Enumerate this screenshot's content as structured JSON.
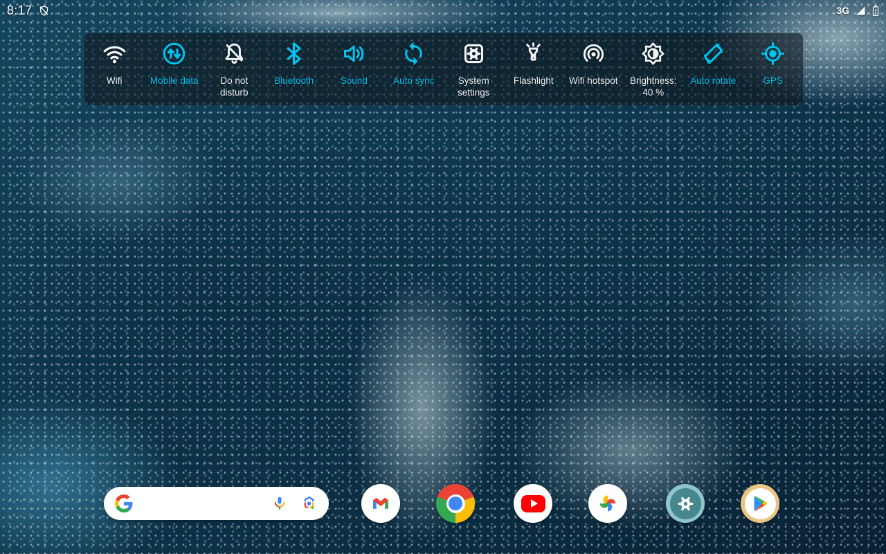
{
  "status_bar": {
    "time": "8:17",
    "shield_icon": "shield-off-icon",
    "network_type": "3G",
    "signal_icon": "signal-full-icon",
    "battery_icon": "battery-icon"
  },
  "quick_settings": {
    "accent_color": "#00c4f0",
    "inactive_color": "#f2f4f5",
    "tiles": [
      {
        "id": "wifi",
        "label": "Wifi",
        "icon": "wifi-icon",
        "active": false
      },
      {
        "id": "mobile-data",
        "label": "Mobile data",
        "icon": "mobile-data-icon",
        "active": true
      },
      {
        "id": "do-not-disturb",
        "label": "Do not disturb",
        "icon": "do-not-disturb-icon",
        "active": false
      },
      {
        "id": "bluetooth",
        "label": "Bluetooth",
        "icon": "bluetooth-icon",
        "active": true
      },
      {
        "id": "sound",
        "label": "Sound",
        "icon": "sound-icon",
        "active": true
      },
      {
        "id": "auto-sync",
        "label": "Auto sync",
        "icon": "auto-sync-icon",
        "active": true
      },
      {
        "id": "system-settings",
        "label": "System settings",
        "icon": "system-settings-icon",
        "active": false
      },
      {
        "id": "flashlight",
        "label": "Flashlight",
        "icon": "flashlight-icon",
        "active": false
      },
      {
        "id": "wifi-hotspot",
        "label": "Wifi hotspot",
        "icon": "wifi-hotspot-icon",
        "active": false
      },
      {
        "id": "brightness",
        "label": "Brightness: 40 %",
        "icon": "brightness-icon",
        "active": false
      },
      {
        "id": "auto-rotate",
        "label": "Auto rotate",
        "icon": "auto-rotate-icon",
        "active": true
      },
      {
        "id": "gps",
        "label": "GPS",
        "icon": "gps-icon",
        "active": true
      }
    ]
  },
  "dock": {
    "search": {
      "value": "",
      "logo": "google-g-logo",
      "mic_icon": "google-mic-icon",
      "lens_icon": "google-lens-icon"
    },
    "apps": [
      {
        "id": "gmail",
        "name": "Gmail"
      },
      {
        "id": "chrome",
        "name": "Chrome"
      },
      {
        "id": "youtube",
        "name": "YouTube"
      },
      {
        "id": "photos",
        "name": "Google Photos"
      },
      {
        "id": "settings",
        "name": "Settings"
      },
      {
        "id": "play-store",
        "name": "Play Store"
      }
    ]
  }
}
